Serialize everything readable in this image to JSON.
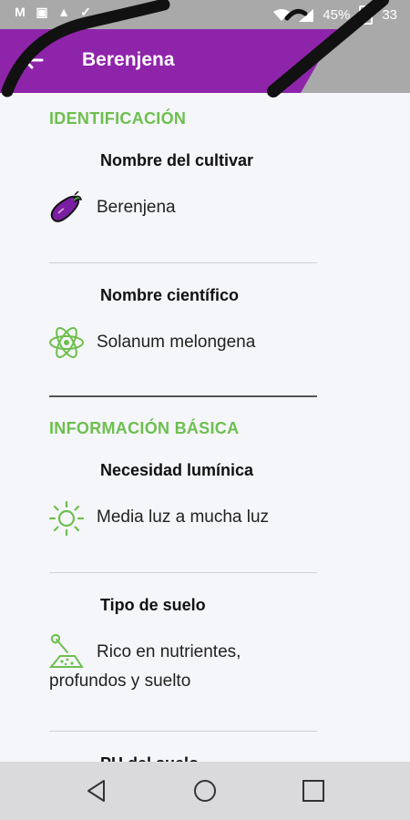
{
  "status_bar": {
    "left_icons": [
      "M",
      "▣",
      "▲",
      "✓",
      "☁"
    ],
    "battery": "45%",
    "time": "33"
  },
  "app_bar": {
    "title": "Berenjena",
    "back_icon": "arrow-left-icon"
  },
  "sections": [
    {
      "title": "IDENTIFICACIÓN",
      "fields": [
        {
          "label": "Nombre del cultivar",
          "value": "Berenjena",
          "icon": "eggplant-icon"
        },
        {
          "label": "Nombre científico",
          "value": "Solanum melongena",
          "icon": "atom-icon"
        }
      ]
    },
    {
      "title": "INFORMACIÓN BÁSICA",
      "fields": [
        {
          "label": "Necesidad lumínica",
          "value": "Media luz a mucha luz",
          "icon": "sun-icon"
        },
        {
          "label": "Tipo de suelo",
          "value_line1": "Rico en nutrientes,",
          "value_line2": "profundos y suelto",
          "icon": "soil-shovel-icon"
        },
        {
          "label": "PH del suelo"
        }
      ]
    }
  ],
  "nav_bar": {
    "back": "triangle-back-icon",
    "home": "circle-home-icon",
    "recents": "square-recents-icon"
  },
  "colors": {
    "accent_purple": "#8e24aa",
    "section_green": "#6dbf4e"
  }
}
